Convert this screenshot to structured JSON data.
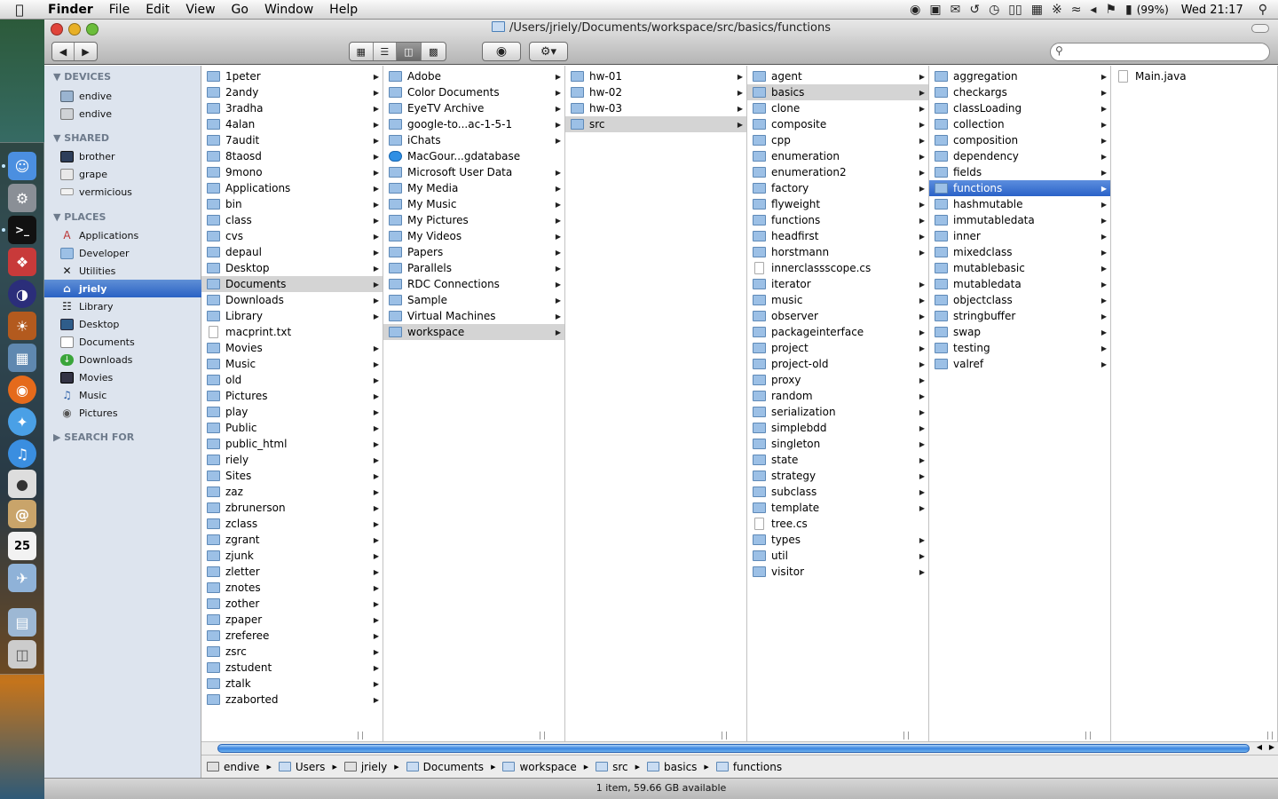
{
  "menubar": {
    "app": "Finder",
    "items": [
      "File",
      "Edit",
      "View",
      "Go",
      "Window",
      "Help"
    ],
    "battery": "(99%)",
    "clock": "Wed 21:17"
  },
  "window": {
    "title": "/Users/jriely/Documents/workspace/src/basics/functions",
    "status": "1 item, 59.66 GB available",
    "search_placeholder": ""
  },
  "sidebar": {
    "devices_header": "DEVICES",
    "devices": [
      "endive",
      "endive"
    ],
    "shared_header": "SHARED",
    "shared": [
      "brother",
      "grape",
      "vermicious"
    ],
    "places_header": "PLACES",
    "places": [
      "Applications",
      "Developer",
      "Utilities",
      "jriely",
      "Library",
      "Desktop",
      "Documents",
      "Downloads",
      "Movies",
      "Music",
      "Pictures"
    ],
    "search_header": "SEARCH FOR"
  },
  "columns": [
    {
      "items": [
        "1peter",
        "2andy",
        "3radha",
        "4alan",
        "7audit",
        "8taosd",
        "9mono",
        "Applications",
        "bin",
        "class",
        "cvs",
        "depaul",
        "Desktop",
        "Documents",
        "Downloads",
        "Library",
        "macprint.txt",
        "Movies",
        "Music",
        "old",
        "Pictures",
        "play",
        "Public",
        "public_html",
        "riely",
        "Sites",
        "zaz",
        "zbrunerson",
        "zclass",
        "zgrant",
        "zjunk",
        "zletter",
        "znotes",
        "zother",
        "zpaper",
        "zreferee",
        "zsrc",
        "zstudent",
        "ztalk",
        "zzaborted"
      ]
    },
    {
      "items": [
        "Adobe",
        "Color Documents",
        "EyeTV Archive",
        "google-to...ac-1-5-1",
        "iChats",
        "MacGour...gdatabase",
        "Microsoft User Data",
        "My Media",
        "My Music",
        "My Pictures",
        "My Videos",
        "Papers",
        "Parallels",
        "RDC Connections",
        "Sample",
        "Virtual Machines",
        "workspace"
      ]
    },
    {
      "items": [
        "hw-01",
        "hw-02",
        "hw-03",
        "src"
      ]
    },
    {
      "items": [
        "agent",
        "basics",
        "clone",
        "composite",
        "cpp",
        "enumeration",
        "enumeration2",
        "factory",
        "flyweight",
        "functions",
        "headfirst",
        "horstmann",
        "innerclassscope.cs",
        "iterator",
        "music",
        "observer",
        "packageinterface",
        "project",
        "project-old",
        "proxy",
        "random",
        "serialization",
        "simplebdd",
        "singleton",
        "state",
        "strategy",
        "subclass",
        "template",
        "tree.cs",
        "types",
        "util",
        "visitor"
      ]
    },
    {
      "items": [
        "aggregation",
        "checkargs",
        "classLoading",
        "collection",
        "composition",
        "dependency",
        "fields",
        "functions",
        "hashmutable",
        "immutabledata",
        "inner",
        "mixedclass",
        "mutablebasic",
        "mutabledata",
        "objectclass",
        "stringbuffer",
        "swap",
        "testing",
        "valref"
      ]
    },
    {
      "items": [
        "Main.java"
      ]
    }
  ],
  "pathbar": [
    "endive",
    "Users",
    "jriely",
    "Documents",
    "workspace",
    "src",
    "basics",
    "functions"
  ]
}
